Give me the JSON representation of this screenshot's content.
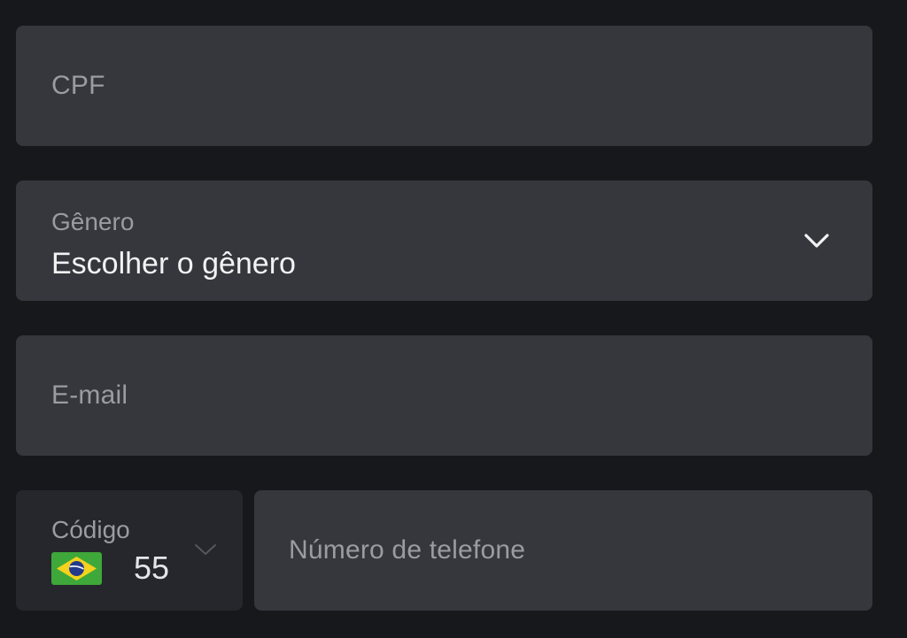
{
  "form": {
    "cpf": {
      "placeholder": "CPF",
      "value": ""
    },
    "gender": {
      "label": "Gênero",
      "value": "Escolher o gênero",
      "icon": "chevron-down-icon"
    },
    "email": {
      "placeholder": "E-mail",
      "value": ""
    },
    "phone_code": {
      "label": "Código",
      "flag": "brazil-flag-icon",
      "dial_code": "55",
      "icon": "chevron-down-icon"
    },
    "phone_number": {
      "placeholder": "Número de telefone",
      "value": ""
    }
  },
  "colors": {
    "background": "#16181c",
    "field": "#35373c",
    "code_field": "#25272c",
    "placeholder_text": "#9a9ca2",
    "value_text": "#f2f2f4"
  }
}
